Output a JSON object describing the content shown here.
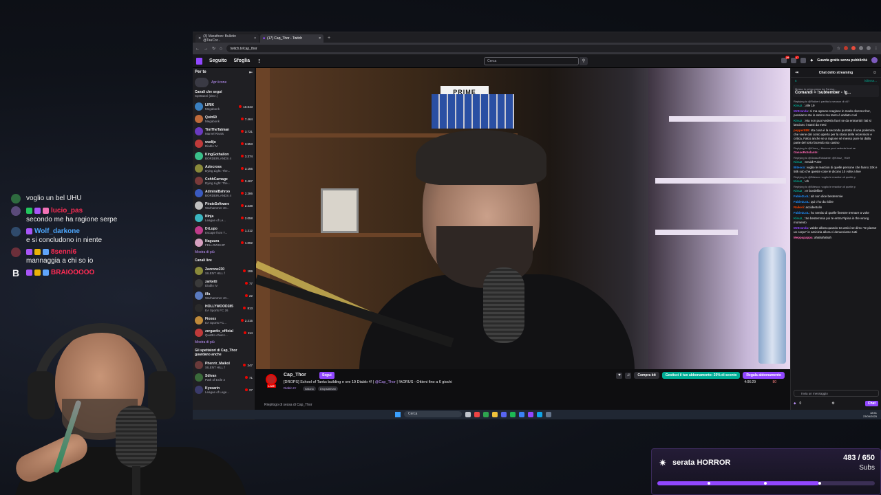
{
  "overlay_chat": [
    {
      "name": "",
      "name_color": "#ffffff",
      "text": "voglio un bel UHU",
      "avatar_color": "#2e6b3f",
      "badges": []
    },
    {
      "name": "lucio_pas",
      "name_color": "#ff2c54",
      "text": "secondo me ha ragione serpe",
      "avatar_color": "#5a4a7a",
      "badges": [
        "#22c55e",
        "#a855f7",
        "#f472b6"
      ]
    },
    {
      "name": "Wolf_darkone",
      "name_color": "#4ea8ff",
      "text": "e si concludono in niente",
      "avatar_color": "#2f4a6b",
      "badges": [
        "#a855f7"
      ]
    },
    {
      "name": "8senni6",
      "name_color": "#ff2c54",
      "text": "mannaggia a chi so io",
      "avatar_color": "#6b2f3a",
      "badges": [
        "#a855f7",
        "#eab308",
        "#60a5fa"
      ]
    },
    {
      "name": "BRAIOOOOO",
      "name_color": "#ff2c54",
      "text": "",
      "avatar_letter": "B",
      "avatar_color": "transparent",
      "badges": [
        "#a855f7",
        "#eab308",
        "#60a5fa"
      ]
    }
  ],
  "subgoal": {
    "title": "serata HORROR",
    "count": "483 / 650",
    "unit": "Subs",
    "progress": 0.743,
    "milestones": [
      0.23,
      0.49,
      0.74
    ]
  },
  "browser": {
    "tabs": [
      {
        "label": "(3) Marathon: Bulletin @TauCor...",
        "active": false
      },
      {
        "label": "(17) Cap_Thor - Twitch",
        "active": true
      }
    ],
    "new_tab": "+",
    "url": "twitch.tv/cap_thor"
  },
  "twitch": {
    "nav": {
      "following": "Seguito",
      "browse": "Sfoglia",
      "more": "⋮",
      "search_placeholder": "Cerca",
      "badge1": "29",
      "badge2": "17",
      "turbo": "Guarda gratis senza pubblicità"
    },
    "sidebar": {
      "title": "Per te",
      "apri": "Apri icone",
      "followed_title": "Canali che segui",
      "followed_sub": "Spettatori (decr.)",
      "followed": [
        {
          "name": "LIRIK",
          "game": "Megabonk",
          "viewers": "10.843",
          "color": "#3a7fbf"
        },
        {
          "name": "Quin69",
          "game": "Megabonk",
          "viewers": "7.464",
          "color": "#bf6a3a"
        },
        {
          "name": "TimTheTatman",
          "game": "Marvel Rivals",
          "viewers": "3.731",
          "color": "#6a3abf"
        },
        {
          "name": "wudijo",
          "game": "Diablo IV",
          "viewers": "3.553",
          "color": "#bf3a3a"
        },
        {
          "name": "KingGothalion",
          "game": "BORDERLANDS 4",
          "viewers": "3.374",
          "color": "#3abf8a"
        },
        {
          "name": "Aztecross",
          "game": "Dying Light: The...",
          "viewers": "3.155",
          "color": "#8a8a3a"
        },
        {
          "name": "CohhCarnage",
          "game": "Dying Light: The...",
          "viewers": "2.467",
          "color": "#7a3a3a"
        },
        {
          "name": "AdmiralBahroo",
          "game": "BORDERLANDS 4",
          "viewers": "2.286",
          "color": "#3a5abf"
        },
        {
          "name": "PirateSoftware",
          "game": "Warhammer 40...",
          "viewers": "2.238",
          "color": "#bfbfbf"
        },
        {
          "name": "Ninja",
          "game": "League of Le...",
          "viewers": "2.058",
          "color": "#3ab5bf"
        },
        {
          "name": "DrLupo",
          "game": "Escape from T...",
          "viewers": "1.312",
          "color": "#bf3a8a"
        },
        {
          "name": "Naguura",
          "game": "FELLOWSHIP",
          "viewers": "1.092",
          "color": "#d6a0c0"
        }
      ],
      "more1": "Mostra di più",
      "live_title": "Canali live",
      "live": [
        {
          "name": "Zazzone230",
          "game": "SILENT HILL f",
          "viewers": "199",
          "color": "#8a8a3a"
        },
        {
          "name": "zarketti",
          "game": "Diablo IV",
          "viewers": "77",
          "color": "#3a3a3a"
        },
        {
          "name": "ilfa",
          "game": "Warhammer 40...",
          "viewers": "22",
          "color": "#5a7abf"
        },
        {
          "name": "HOLLYWOOD285",
          "game": "EA Sports FC 26",
          "viewers": "813",
          "color": "#2a2a2a"
        },
        {
          "name": "Fioxox",
          "game": "EA Sports FC...",
          "viewers": "2.215",
          "color": "#bf8a3a"
        },
        {
          "name": "zergantix_official",
          "game": "Quattro chiacc...",
          "viewers": "114",
          "color": "#bf3a3a"
        }
      ],
      "more2": "Mostra di più",
      "also_title": "Gli spettatori di Cap_Thor guardano anche",
      "also": [
        {
          "name": "Phenrir_Maikol",
          "game": "SILENT HILL f",
          "viewers": "247",
          "color": "#6a3a3a"
        },
        {
          "name": "Sdivan",
          "game": "Path of Exile 2",
          "viewers": "71",
          "color": "#3a6a3a"
        },
        {
          "name": "Kyssarin",
          "game": "League of Lege...",
          "viewers": "27",
          "color": "#3a3a6a"
        }
      ]
    },
    "stream": {
      "channel": "Cap_Thor",
      "follow": "Segui",
      "title_pre": "[DROPS] School of Tanks building e ore 19 Diablo 4! | ",
      "title_mention": "@Cap_Thor",
      "title_post": " | !AORUS - Ottieni fino a 6 giochi",
      "game": "Diablo IV",
      "tags": [
        "Italiano",
        "DropsAttivati"
      ],
      "live": "LIVE",
      "viewers": "80",
      "uptime": "4:06:29",
      "btn_buy": "Compra bit",
      "btn_sub_offer": "Gestisci il tuo abbonamento: 25% di sconto",
      "btn_gift": "Regala abbonamento",
      "below": "Riepilogo di sessa di Cap_Thor"
    },
    "chat": {
      "header": "Chat dello streaming",
      "pin_left": "5",
      "pin_right": "killerse...",
      "pinned_label": "Messo in primo piano da Fanbur...",
      "pinned_text": "Comandi = !subtember - !g...",
      "messages": [
        {
          "reply": "Replying to @Raikeri: partita la season di d4?",
          "user": "Kinuz_",
          "color": "#00ad96",
          "text": "alle 19"
        },
        {
          "reply": "",
          "user": "MrBranda",
          "color": "#9147ff",
          "text": "si ma ognuno reagisce in modo diverso thor, possiamo sta in eterno ma tanto è andato così"
        },
        {
          "reply": "",
          "user": "Kinuz_",
          "color": "#00ad96",
          "text": "Ma non puoi vederla fuori se da entrambi i lati si lanciano i sassi da mesi"
        },
        {
          "reply": "",
          "user": "pepper889",
          "color": "#ff4500",
          "text": "sta cosa è la seconda puntata di una polemica che viene dal conto aperto per la storia delle recensioni e critica, Falco anche se a ragione sè messo pure lui dalla parte del torto facendo sto casino"
        },
        {
          "reply": "Replying to @Kinuz_: Ma non puoi vederla fuori se",
          "user": "GassoRotolante",
          "color": "#ff69b4",
          "text": ""
        },
        {
          "reply": "Replying to @GassoRotolante: @Kinuz_ HUH",
          "user": "Kinuz_",
          "color": "#00ad96",
          "text": "Druid Pulve"
        },
        {
          "reply": "",
          "user": "Bitesco",
          "color": "#1e90ff",
          "text": "voglio le reaction di quelle persone che fanno 10k e 50k sub che queste cose le dicono 10 volte a live"
        },
        {
          "reply": "Replying to @Bitesco: voglio le reaction di quelle p",
          "user": "Kinuz_",
          "color": "#00ad96",
          "text": "eh"
        },
        {
          "reply": "Replying to @Bitesco: voglio le reaction di quelle p",
          "user": "Kinuz_",
          "color": "#00ad96",
          "text": "er bordelline"
        },
        {
          "reply": "",
          "user": "Fabie2LoL",
          "color": "#1e90ff",
          "text": "ah non dice bestemmie"
        },
        {
          "reply": "",
          "user": "Fabie2LoL",
          "color": "#1e90ff",
          "text": "qui c'ho da ridire"
        },
        {
          "reply": "",
          "user": "Raikeri",
          "color": "#ff4500",
          "text": "accidentolin"
        },
        {
          "reply": "",
          "user": "Fabie2LoL",
          "color": "#1e90ff",
          "text": "ho sentito di quelle finestre tremare a volte"
        },
        {
          "reply": "",
          "user": "Kinuz_",
          "color": "#00ad96",
          "text": "Se bestemmia poi te entra Pipina in the wrong momento"
        },
        {
          "reply": "",
          "user": "MrBranda",
          "color": "#9147ff",
          "text": "vabbe allora quando tra amici se dimo \"te piasse un corpo\" in amicizia allora ci denunciamo tutti"
        },
        {
          "reply": "",
          "user": "Meppapappa",
          "color": "#ff69b4",
          "text": "ahahahahah"
        }
      ],
      "input_placeholder": "Invia un messaggio",
      "points": "0",
      "send": "Chat"
    },
    "taskbar": {
      "search": "Cerca",
      "time": "18:51",
      "date": "23/09/2025"
    }
  }
}
